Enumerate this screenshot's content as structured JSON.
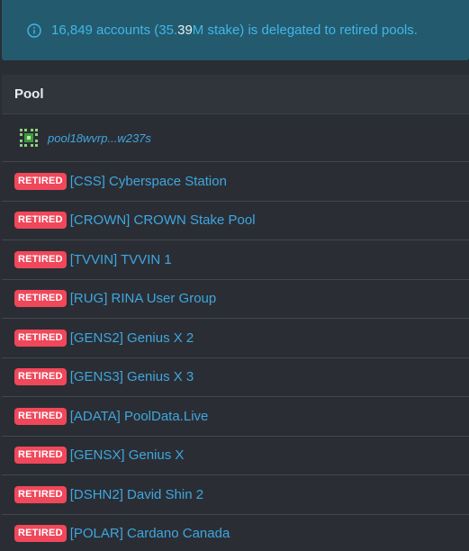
{
  "alert": {
    "text_before": "16,849 accounts (35.",
    "text_highlight": "39",
    "text_after": "M stake) is delegated to retired pools."
  },
  "table": {
    "header": "Pool",
    "first_row": {
      "pool_id": "pool18wvrp...w237s"
    },
    "retired_badge": "RETIRED",
    "rows": [
      {
        "name": "[CSS] Cyberspace Station"
      },
      {
        "name": "[CROWN] CROWN Stake Pool"
      },
      {
        "name": "[TVVIN] TVVIN 1"
      },
      {
        "name": "[RUG] RINA User Group"
      },
      {
        "name": "[GENS2] Genius X 2"
      },
      {
        "name": "[GENS3] Genius X 3"
      },
      {
        "name": "[ADATA] PoolData.Live"
      },
      {
        "name": "[GENSX] Genius X"
      },
      {
        "name": "[DSHN2] David Shin 2"
      },
      {
        "name": "[POLAR] Cardano Canada"
      }
    ]
  },
  "colors": {
    "background": "#2a2e34",
    "alert_background": "#245a6e",
    "link": "#3fa6e0",
    "badge": "#f0475a"
  }
}
